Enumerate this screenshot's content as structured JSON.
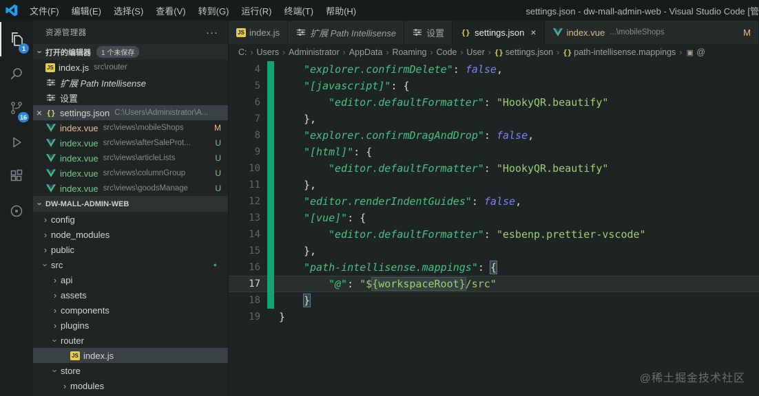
{
  "title_bar": {
    "menus": [
      {
        "id": "file",
        "label": "文件(F)"
      },
      {
        "id": "edit",
        "label": "编辑(E)"
      },
      {
        "id": "selection",
        "label": "选择(S)"
      },
      {
        "id": "view",
        "label": "查看(V)"
      },
      {
        "id": "go",
        "label": "转到(G)"
      },
      {
        "id": "run",
        "label": "运行(R)"
      },
      {
        "id": "terminal",
        "label": "终端(T)"
      },
      {
        "id": "help",
        "label": "帮助(H)"
      }
    ],
    "title": "settings.json - dw-mall-admin-web - Visual Studio Code [管"
  },
  "activity_bar": {
    "badge_color": "#2d87d3",
    "items": [
      {
        "id": "explorer",
        "badge": "1",
        "active": true
      },
      {
        "id": "search"
      },
      {
        "id": "source-control",
        "badge": "16"
      },
      {
        "id": "run-debug"
      },
      {
        "id": "extensions"
      },
      {
        "id": "circle"
      }
    ]
  },
  "sidebar": {
    "title": "资源管理器",
    "more_label": "···",
    "open_editors": {
      "label": "打开的编辑器",
      "badge": "1 个未保存",
      "items": [
        {
          "icon": "js",
          "name": "index.js",
          "desc": "src\\router"
        },
        {
          "icon": "tune",
          "name": "扩展 Path Intellisense",
          "italic": true
        },
        {
          "icon": "tune",
          "name": "设置"
        },
        {
          "icon": "json",
          "name": "settings.json",
          "desc": "C:\\Users\\Administrator\\A...",
          "selected": true,
          "close": true
        },
        {
          "icon": "vue",
          "name": "index.vue",
          "desc": "src\\views\\mobileShops",
          "badge": "M"
        },
        {
          "icon": "vue",
          "name": "index.vue",
          "desc": "src\\views\\afterSaleProt...",
          "badge": "U"
        },
        {
          "icon": "vue",
          "name": "index.vue",
          "desc": "src\\views\\articleLists",
          "badge": "U"
        },
        {
          "icon": "vue",
          "name": "index.vue",
          "desc": "src\\views\\columnGroup",
          "badge": "U"
        },
        {
          "icon": "vue",
          "name": "index.vue",
          "desc": "src\\views\\goodsManage",
          "badge": "U"
        }
      ]
    },
    "project": {
      "label": "DW-MALL-ADMIN-WEB",
      "tree": [
        {
          "type": "folder",
          "name": "config",
          "level": 0
        },
        {
          "type": "folder",
          "name": "node_modules",
          "level": 0
        },
        {
          "type": "folder",
          "name": "public",
          "level": 0
        },
        {
          "type": "folder",
          "name": "src",
          "level": 0,
          "expanded": true,
          "dot": true
        },
        {
          "type": "folder",
          "name": "api",
          "level": 1
        },
        {
          "type": "folder",
          "name": "assets",
          "level": 1
        },
        {
          "type": "folder",
          "name": "components",
          "level": 1
        },
        {
          "type": "folder",
          "name": "plugins",
          "level": 1
        },
        {
          "type": "folder",
          "name": "router",
          "level": 1,
          "expanded": true
        },
        {
          "type": "file",
          "icon": "js",
          "name": "index.js",
          "level": 2,
          "selected": true
        },
        {
          "type": "folder",
          "name": "store",
          "level": 1,
          "expanded": true
        },
        {
          "type": "folder",
          "name": "modules",
          "level": 2
        }
      ]
    }
  },
  "editor": {
    "tabs": [
      {
        "id": "tab-index-js",
        "icon": "js",
        "label": "index.js"
      },
      {
        "id": "tab-path-intellisense",
        "icon": "tune",
        "label": "扩展 Path Intellisense",
        "italic": true
      },
      {
        "id": "tab-settings-ui",
        "icon": "tune",
        "label": "设置"
      },
      {
        "id": "tab-settings-json",
        "icon": "json",
        "label": "settings.json",
        "active": true,
        "close": true
      },
      {
        "id": "tab-index-vue",
        "icon": "vue",
        "label": "index.vue",
        "desc": "...\\mobileShops",
        "badge": "M"
      }
    ],
    "breadcrumb": [
      {
        "label": "C:"
      },
      {
        "label": "Users"
      },
      {
        "label": "Administrator"
      },
      {
        "label": "AppData"
      },
      {
        "label": "Roaming"
      },
      {
        "label": "Code"
      },
      {
        "label": "User"
      },
      {
        "label": "settings.json",
        "icon": "json"
      },
      {
        "label": "path-intellisense.mappings",
        "icon": "json"
      },
      {
        "label": "@",
        "icon": "symbol"
      }
    ]
  },
  "code": {
    "language": "json",
    "modified_gutter_color": "#12a474",
    "lines": [
      {
        "num": 4,
        "indent": 1,
        "changed": true,
        "tokens": [
          {
            "t": "\"explorer.confirmDelete\"",
            "c": "k"
          },
          {
            "t": ": ",
            "c": "p"
          },
          {
            "t": "false",
            "c": "b"
          },
          {
            "t": ",",
            "c": "p"
          }
        ]
      },
      {
        "num": 5,
        "indent": 1,
        "changed": true,
        "tokens": [
          {
            "t": "\"[javascript]\"",
            "c": "k"
          },
          {
            "t": ": {",
            "c": "p"
          }
        ]
      },
      {
        "num": 6,
        "indent": 2,
        "changed": true,
        "tokens": [
          {
            "t": "\"editor.defaultFormatter\"",
            "c": "k"
          },
          {
            "t": ": ",
            "c": "p"
          },
          {
            "t": "\"HookyQR.beautify\"",
            "c": "s"
          }
        ]
      },
      {
        "num": 7,
        "indent": 1,
        "changed": true,
        "tokens": [
          {
            "t": "},",
            "c": "p"
          }
        ]
      },
      {
        "num": 8,
        "indent": 1,
        "changed": true,
        "tokens": [
          {
            "t": "\"explorer.confirmDragAndDrop\"",
            "c": "k"
          },
          {
            "t": ": ",
            "c": "p"
          },
          {
            "t": "false",
            "c": "b"
          },
          {
            "t": ",",
            "c": "p"
          }
        ]
      },
      {
        "num": 9,
        "indent": 1,
        "changed": true,
        "tokens": [
          {
            "t": "\"[html]\"",
            "c": "k"
          },
          {
            "t": ": {",
            "c": "p"
          }
        ]
      },
      {
        "num": 10,
        "indent": 2,
        "changed": true,
        "tokens": [
          {
            "t": "\"editor.defaultFormatter\"",
            "c": "k"
          },
          {
            "t": ": ",
            "c": "p"
          },
          {
            "t": "\"HookyQR.beautify\"",
            "c": "s"
          }
        ]
      },
      {
        "num": 11,
        "indent": 1,
        "changed": true,
        "tokens": [
          {
            "t": "},",
            "c": "p"
          }
        ]
      },
      {
        "num": 12,
        "indent": 1,
        "changed": true,
        "tokens": [
          {
            "t": "\"editor.renderIndentGuides\"",
            "c": "k"
          },
          {
            "t": ": ",
            "c": "p"
          },
          {
            "t": "false",
            "c": "b"
          },
          {
            "t": ",",
            "c": "p"
          }
        ]
      },
      {
        "num": 13,
        "indent": 1,
        "changed": true,
        "tokens": [
          {
            "t": "\"[vue]\"",
            "c": "k"
          },
          {
            "t": ": {",
            "c": "p"
          }
        ]
      },
      {
        "num": 14,
        "indent": 2,
        "changed": true,
        "tokens": [
          {
            "t": "\"editor.defaultFormatter\"",
            "c": "k"
          },
          {
            "t": ": ",
            "c": "p"
          },
          {
            "t": "\"esbenp.prettier-vscode\"",
            "c": "s"
          }
        ]
      },
      {
        "num": 15,
        "indent": 1,
        "changed": true,
        "tokens": [
          {
            "t": "},",
            "c": "p"
          }
        ]
      },
      {
        "num": 16,
        "indent": 1,
        "changed": true,
        "tokens": [
          {
            "t": "\"path-intellisense.mappings\"",
            "c": "k"
          },
          {
            "t": ": ",
            "c": "p"
          },
          {
            "t": "{",
            "c": "bm"
          }
        ]
      },
      {
        "num": 17,
        "indent": 2,
        "changed": true,
        "current": true,
        "tokens": [
          {
            "t": "\"@\"",
            "c": "k"
          },
          {
            "t": ": ",
            "c": "p"
          },
          {
            "t": "\"$",
            "c": "s"
          },
          {
            "t": "{workspaceRoot}",
            "c": "sb"
          },
          {
            "t": "/src\"",
            "c": "s"
          }
        ]
      },
      {
        "num": 18,
        "indent": 1,
        "changed": true,
        "tokens": [
          {
            "t": "}",
            "c": "bm"
          }
        ]
      },
      {
        "num": 19,
        "indent": 0,
        "changed": false,
        "tokens": [
          {
            "t": "}",
            "c": "p"
          }
        ]
      }
    ]
  },
  "watermark": "@稀土掘金技术社区"
}
